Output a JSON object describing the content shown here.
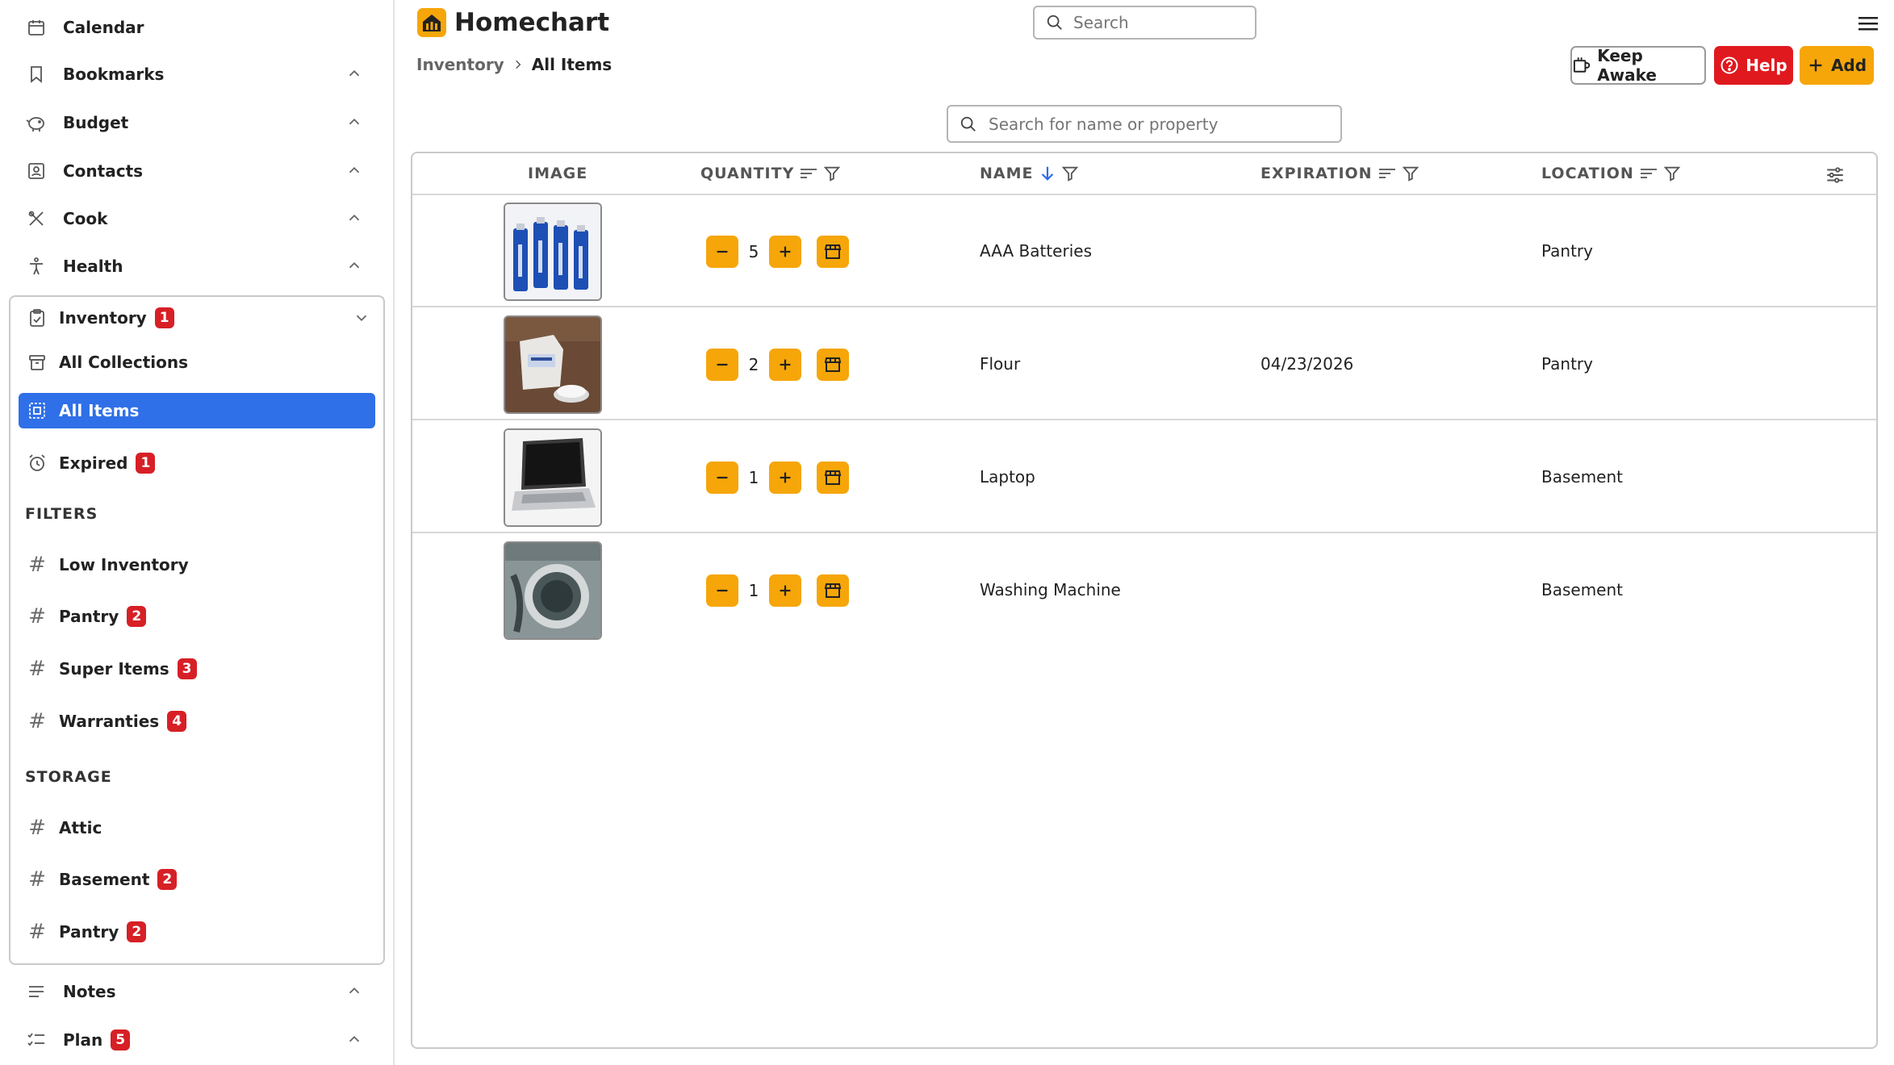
{
  "sidebar": {
    "calendar": "Calendar",
    "bookmarks": "Bookmarks",
    "budget": "Budget",
    "contacts": "Contacts",
    "cook": "Cook",
    "health": "Health",
    "inventory": {
      "label": "Inventory",
      "badge": "1"
    },
    "all_collections": "All Collections",
    "all_items": "All Items",
    "expired": {
      "label": "Expired",
      "badge": "1"
    },
    "filters_heading": "FILTERS",
    "filters": [
      {
        "label": "Low Inventory",
        "badge": ""
      },
      {
        "label": "Pantry",
        "badge": "2"
      },
      {
        "label": "Super Items",
        "badge": "3"
      },
      {
        "label": "Warranties",
        "badge": "4"
      }
    ],
    "storage_heading": "STORAGE",
    "storage": [
      {
        "label": "Attic",
        "badge": ""
      },
      {
        "label": "Basement",
        "badge": "2"
      },
      {
        "label": "Pantry",
        "badge": "2"
      }
    ],
    "notes": "Notes",
    "plan": {
      "label": "Plan",
      "badge": "5"
    }
  },
  "header": {
    "app_name": "Homechart",
    "search_placeholder": "Search",
    "breadcrumb": [
      "Inventory",
      "All Items"
    ],
    "keep_awake": "Keep Awake",
    "help": "Help",
    "add": "Add"
  },
  "table": {
    "search_placeholder": "Search for name or property",
    "columns": {
      "image": "IMAGE",
      "quantity": "QUANTITY",
      "name": "NAME",
      "expiration": "EXPIRATION",
      "location": "LOCATION"
    },
    "rows": [
      {
        "quantity": "5",
        "name": "AAA Batteries",
        "expiration": "",
        "location": "Pantry",
        "image": "batteries"
      },
      {
        "quantity": "2",
        "name": "Flour",
        "expiration": "04/23/2026",
        "location": "Pantry",
        "image": "flour"
      },
      {
        "quantity": "1",
        "name": "Laptop",
        "expiration": "",
        "location": "Basement",
        "image": "laptop"
      },
      {
        "quantity": "1",
        "name": "Washing Machine",
        "expiration": "",
        "location": "Basement",
        "image": "washer"
      }
    ]
  },
  "colors": {
    "accent": "#f6a609",
    "active": "#2f6fe8",
    "danger": "#e0191f",
    "badge": "#d71f26"
  }
}
